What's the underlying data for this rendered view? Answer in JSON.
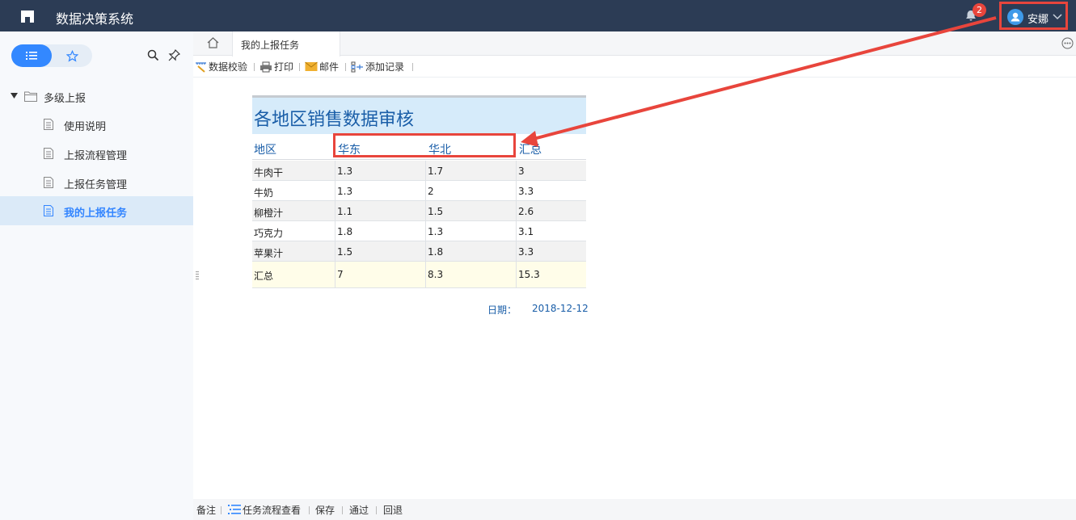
{
  "header": {
    "app_title": "数据决策系统",
    "notification_count": "2",
    "user_name": "安娜"
  },
  "sidebar": {
    "root_label": "多级上报",
    "items": [
      {
        "label": "使用说明"
      },
      {
        "label": "上报流程管理"
      },
      {
        "label": "上报任务管理"
      },
      {
        "label": "我的上报任务",
        "active": true
      }
    ]
  },
  "tabs": {
    "active_tab": "我的上报任务"
  },
  "toolbar": {
    "validate": "数据校验",
    "print": "打印",
    "mail": "邮件",
    "add_record": "添加记录"
  },
  "report": {
    "title": "各地区销售数据审核",
    "headers": [
      "地区",
      "华东",
      "华北",
      "汇总"
    ],
    "rows": [
      [
        "牛肉干",
        "1.3",
        "1.7",
        "3"
      ],
      [
        "牛奶",
        "1.3",
        "2",
        "3.3"
      ],
      [
        "柳橙汁",
        "1.1",
        "1.5",
        "2.6"
      ],
      [
        "巧克力",
        "1.8",
        "1.3",
        "3.1"
      ],
      [
        "苹果汁",
        "1.5",
        "1.8",
        "3.3"
      ]
    ],
    "total": [
      "汇总",
      "7",
      "8.3",
      "15.3"
    ],
    "date_label": "日期：",
    "date_value": "2018-12-12"
  },
  "bottombar": {
    "note": "备注",
    "flow_view": "任务流程查看",
    "save": "保存",
    "approve": "通过",
    "reject": "回退"
  },
  "colors": {
    "topbar": "#2c3c55",
    "accent": "#3388ff",
    "highlight": "#e8453c",
    "report_blue": "#1a5ea8"
  }
}
